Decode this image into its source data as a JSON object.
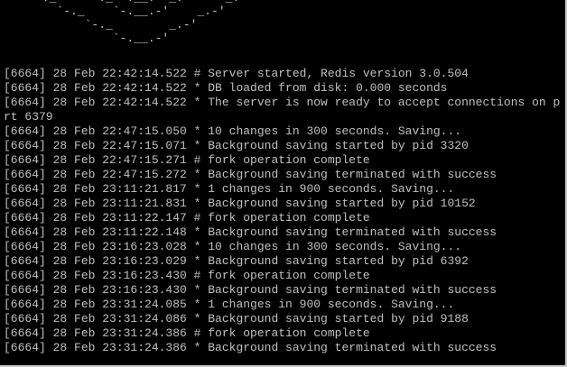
{
  "console": {
    "banner": [
      "    `-._    `-._`-.__.-'_.-'    _.-'",
      "        `-._    `-.__.-'    _.-'",
      "            `-._        _.-'",
      "                `-.__.-'"
    ],
    "log_lines": [
      "[6664] 28 Feb 22:42:14.522 # Server started, Redis version 3.0.504",
      "[6664] 28 Feb 22:42:14.522 * DB loaded from disk: 0.000 seconds",
      "[6664] 28 Feb 22:42:14.522 * The server is now ready to accept connections on p",
      "rt 6379",
      "[6664] 28 Feb 22:47:15.050 * 10 changes in 300 seconds. Saving...",
      "[6664] 28 Feb 22:47:15.071 * Background saving started by pid 3320",
      "[6664] 28 Feb 22:47:15.271 # fork operation complete",
      "[6664] 28 Feb 22:47:15.272 * Background saving terminated with success",
      "[6664] 28 Feb 23:11:21.817 * 1 changes in 900 seconds. Saving...",
      "[6664] 28 Feb 23:11:21.831 * Background saving started by pid 10152",
      "[6664] 28 Feb 23:11:22.147 # fork operation complete",
      "[6664] 28 Feb 23:11:22.148 * Background saving terminated with success",
      "[6664] 28 Feb 23:16:23.028 * 10 changes in 300 seconds. Saving...",
      "[6664] 28 Feb 23:16:23.029 * Background saving started by pid 6392",
      "[6664] 28 Feb 23:16:23.430 # fork operation complete",
      "[6664] 28 Feb 23:16:23.430 * Background saving terminated with success",
      "[6664] 28 Feb 23:31:24.085 * 1 changes in 900 seconds. Saving...",
      "[6664] 28 Feb 23:31:24.086 * Background saving started by pid 9188",
      "[6664] 28 Feb 23:31:24.386 # fork operation complete",
      "[6664] 28 Feb 23:31:24.386 * Background saving terminated with success"
    ]
  },
  "colors": {
    "background": "#000000",
    "text": "#c0c0c0"
  }
}
